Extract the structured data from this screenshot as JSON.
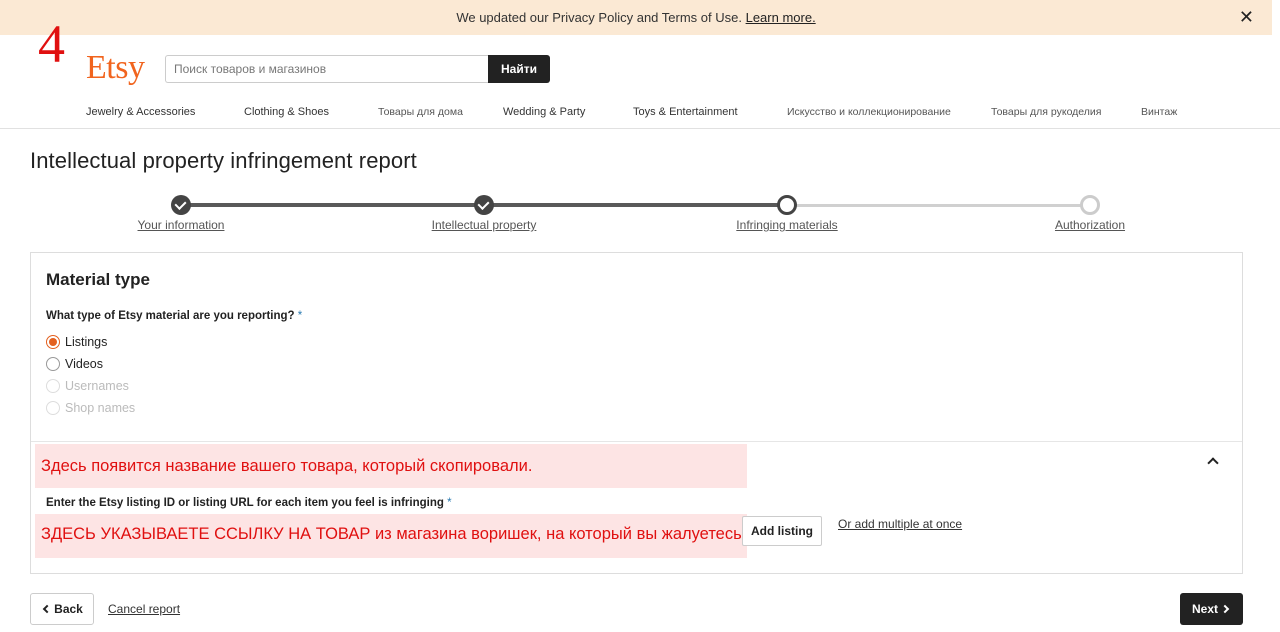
{
  "banner": {
    "text": "We updated our Privacy Policy and Terms of Use.",
    "link": "Learn more.",
    "close_icon": "close-icon"
  },
  "annotation_step": "4",
  "logo": "Etsy",
  "search": {
    "placeholder": "Поиск товаров и магазинов",
    "button": "Найти"
  },
  "categories": [
    "Jewelry & Accessories",
    "Clothing & Shoes",
    "Товары для дома",
    "Wedding & Party",
    "Toys & Entertainment",
    "Искусство и коллекционирование",
    "Товары для рукоделия",
    "Винтаж"
  ],
  "page_title": "Intellectual property infringement report",
  "steps": [
    {
      "label": "Your information",
      "state": "done"
    },
    {
      "label": "Intellectual property",
      "state": "done"
    },
    {
      "label": "Infringing materials",
      "state": "current"
    },
    {
      "label": "Authorization",
      "state": "todo"
    }
  ],
  "material": {
    "title": "Material type",
    "question": "What type of Etsy material are you reporting?",
    "required_mark": "*",
    "options": [
      {
        "label": "Listings",
        "selected": true,
        "disabled": false
      },
      {
        "label": "Videos",
        "selected": false,
        "disabled": false
      },
      {
        "label": "Usernames",
        "selected": false,
        "disabled": true
      },
      {
        "label": "Shop names",
        "selected": false,
        "disabled": true
      }
    ]
  },
  "listing": {
    "field_label": "Enter the Etsy listing ID or listing URL for each item you feel is infringing",
    "required_mark": "*",
    "add_button": "Add listing",
    "add_multiple": "Or add multiple at once"
  },
  "annotations": {
    "title_note": "Здесь появится название вашего товара, который скопировали.",
    "url_note": "ЗДЕСЬ УКАЗЫВАЕТЕ ССЫЛКУ НА ТОВАР из магазина воришек, на который вы жалуетесь."
  },
  "footer": {
    "back": "Back",
    "cancel": "Cancel report",
    "next": "Next"
  },
  "colors": {
    "accent": "#f1641e",
    "banner_bg": "#fbe9d4",
    "annotation_red": "#e01010",
    "annotation_bg": "#fde4e4"
  }
}
